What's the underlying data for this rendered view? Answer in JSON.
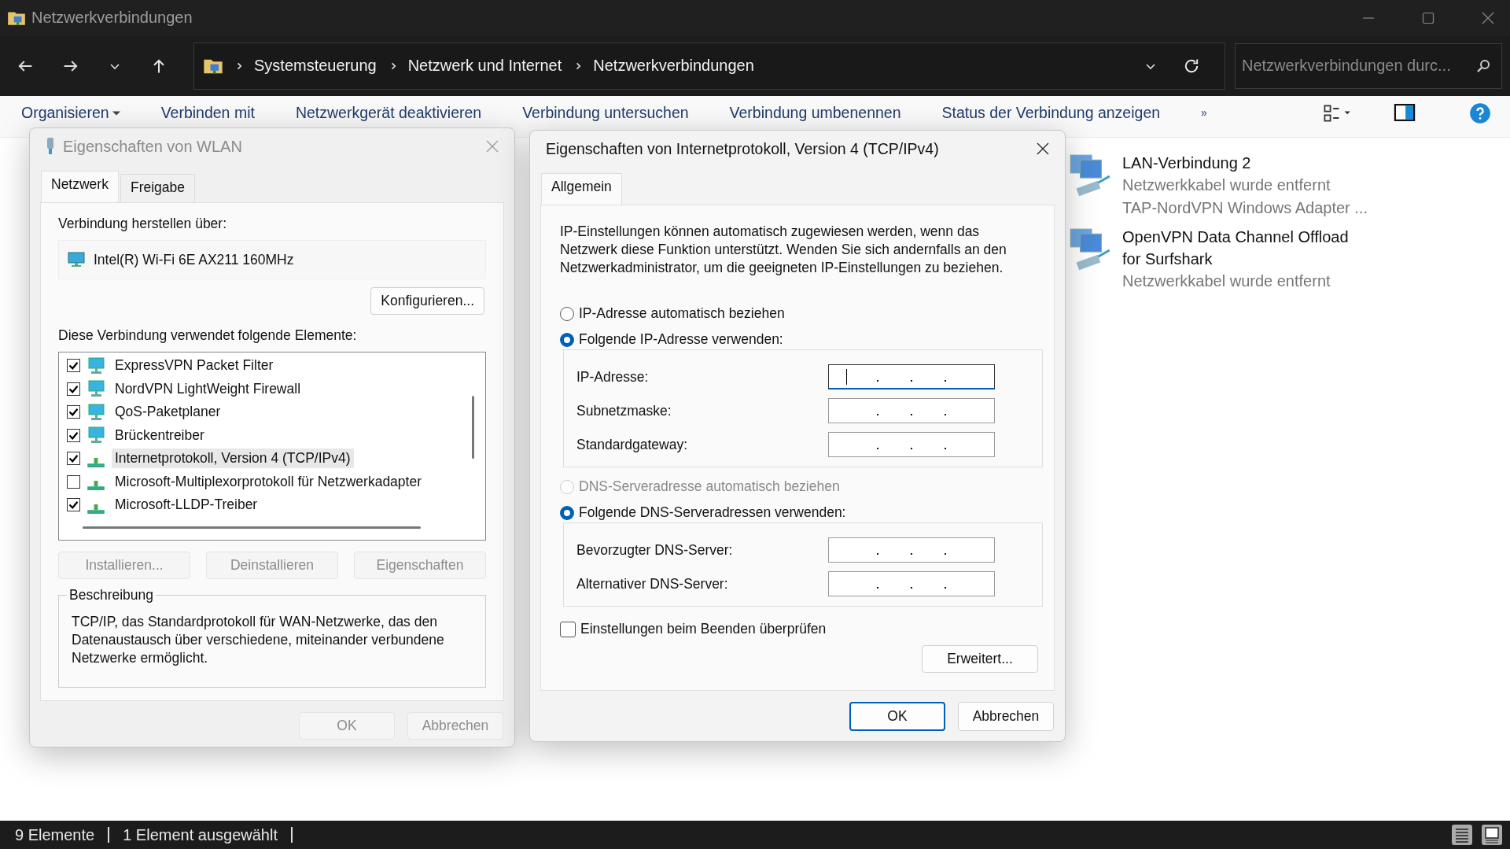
{
  "window": {
    "title": "Netzwerkverbindungen"
  },
  "address_bar": {
    "path": [
      "Systemsteuerung",
      "Netzwerk und Internet",
      "Netzwerkverbindungen"
    ]
  },
  "search": {
    "placeholder": "Netzwerkverbindungen durc..."
  },
  "toolbar": {
    "items": [
      {
        "label": "Organisieren",
        "dropdown": true
      },
      {
        "label": "Verbinden mit",
        "dropdown": false
      },
      {
        "label": "Netzwerkgerät deaktivieren",
        "dropdown": false
      },
      {
        "label": "Verbindung untersuchen",
        "dropdown": false
      },
      {
        "label": "Verbindung umbenennen",
        "dropdown": false
      },
      {
        "label": "Status der Verbindung anzeigen",
        "dropdown": false
      }
    ],
    "overflow": "»"
  },
  "connections": [
    {
      "name": "LAN-Verbindung 2",
      "status": "Netzwerkkabel wurde entfernt",
      "device": "TAP-NordVPN Windows Adapter ..."
    },
    {
      "name": "OpenVPN Data Channel Offload for Surfshark",
      "status": "Netzwerkkabel wurde entfernt"
    }
  ],
  "wlan_dialog": {
    "title": "Eigenschaften von WLAN",
    "active": false,
    "tabs": [
      {
        "label": "Netzwerk",
        "selected": true
      },
      {
        "label": "Freigabe",
        "selected": false
      }
    ],
    "connect_label": "Verbindung herstellen über:",
    "adapter": "Intel(R) Wi-Fi 6E AX211 160MHz",
    "configure_button": "Konfigurieren...",
    "components_label": "Diese Verbindung verwendet folgende Elemente:",
    "components": [
      {
        "label": "ExpressVPN Packet Filter",
        "checked": true,
        "kind": "service",
        "selected": false
      },
      {
        "label": "NordVPN LightWeight Firewall",
        "checked": true,
        "kind": "service",
        "selected": false
      },
      {
        "label": "QoS-Paketplaner",
        "checked": true,
        "kind": "service",
        "selected": false
      },
      {
        "label": "Brückentreiber",
        "checked": true,
        "kind": "service",
        "selected": false
      },
      {
        "label": "Internetprotokoll, Version 4 (TCP/IPv4)",
        "checked": true,
        "kind": "protocol",
        "selected": true
      },
      {
        "label": "Microsoft-Multiplexorprotokoll für Netzwerkadapter",
        "checked": false,
        "kind": "protocol",
        "selected": false
      },
      {
        "label": "Microsoft-LLDP-Treiber",
        "checked": true,
        "kind": "protocol",
        "selected": false
      }
    ],
    "component_buttons": [
      {
        "label": "Installieren...",
        "disabled": true
      },
      {
        "label": "Deinstallieren",
        "disabled": true
      },
      {
        "label": "Eigenschaften",
        "disabled": true
      }
    ],
    "description": {
      "title": "Beschreibung",
      "text": "TCP/IP, das Standardprotokoll für WAN-Netzwerke, das den Datenaustausch über verschiedene, miteinander verbundene Netzwerke ermöglicht."
    },
    "buttons": [
      {
        "label": "OK",
        "disabled": true
      },
      {
        "label": "Abbrechen",
        "disabled": true
      }
    ]
  },
  "ipv4_dialog": {
    "title": "Eigenschaften von Internetprotokoll, Version 4 (TCP/IPv4)",
    "active": true,
    "tabs": [
      {
        "label": "Allgemein",
        "selected": true
      }
    ],
    "intro": "IP-Einstellungen können automatisch zugewiesen werden, wenn das Netzwerk diese Funktion unterstützt. Wenden Sie sich andernfalls an den Netzwerkadministrator, um die geeigneten IP-Einstellungen zu beziehen.",
    "ip_modes": [
      {
        "label": "IP-Adresse automatisch beziehen",
        "selected": false,
        "disabled": false
      },
      {
        "label": "Folgende IP-Adresse verwenden:",
        "selected": true,
        "disabled": false
      }
    ],
    "ip_fields": [
      {
        "label": "IP-Adresse:",
        "focused": true
      },
      {
        "label": "Subnetzmaske:",
        "focused": false
      },
      {
        "label": "Standardgateway:",
        "focused": false
      }
    ],
    "dns_modes": [
      {
        "label": "DNS-Serveradresse automatisch beziehen",
        "selected": false,
        "disabled": true
      },
      {
        "label": "Folgende DNS-Serveradressen verwenden:",
        "selected": true,
        "disabled": false
      }
    ],
    "dns_fields": [
      {
        "label": "Bevorzugter DNS-Server:",
        "focused": false
      },
      {
        "label": "Alternativer DNS-Server:",
        "focused": false
      }
    ],
    "validate": {
      "label": "Einstellungen beim Beenden überprüfen",
      "checked": false
    },
    "advanced_button": "Erweitert...",
    "buttons": [
      {
        "label": "OK",
        "default": true
      },
      {
        "label": "Abbrechen",
        "default": false
      }
    ]
  },
  "status_bar": {
    "items": [
      "9 Elemente",
      "1 Element ausgewählt"
    ]
  }
}
